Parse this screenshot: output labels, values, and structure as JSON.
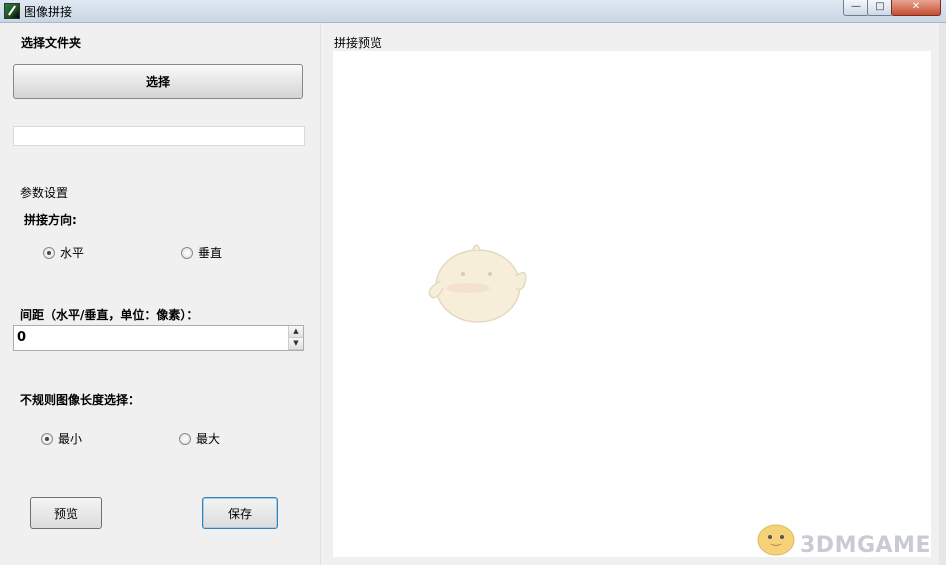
{
  "window": {
    "title": "图像拼接",
    "buttons": {
      "minimize": "—",
      "maximize": "□",
      "close": "✕"
    }
  },
  "left": {
    "folder_section_label": "选择文件夹",
    "select_button": "选择",
    "folder_path_value": "",
    "params_label": "参数设置",
    "direction_label": "拼接方向:",
    "direction_options": [
      {
        "label": "水平",
        "checked": true
      },
      {
        "label": "垂直",
        "checked": false
      }
    ],
    "spacing_label": "间距（水平/垂直，单位：像素）：",
    "spacing_value": "0",
    "irregular_label": "不规则图像长度选择：",
    "length_options": [
      {
        "label": "最小",
        "checked": true
      },
      {
        "label": "最大",
        "checked": false
      }
    ],
    "preview_button": "预览",
    "save_button": "保存"
  },
  "right": {
    "preview_label": "拼接预览",
    "watermark": "3DMGAME"
  }
}
